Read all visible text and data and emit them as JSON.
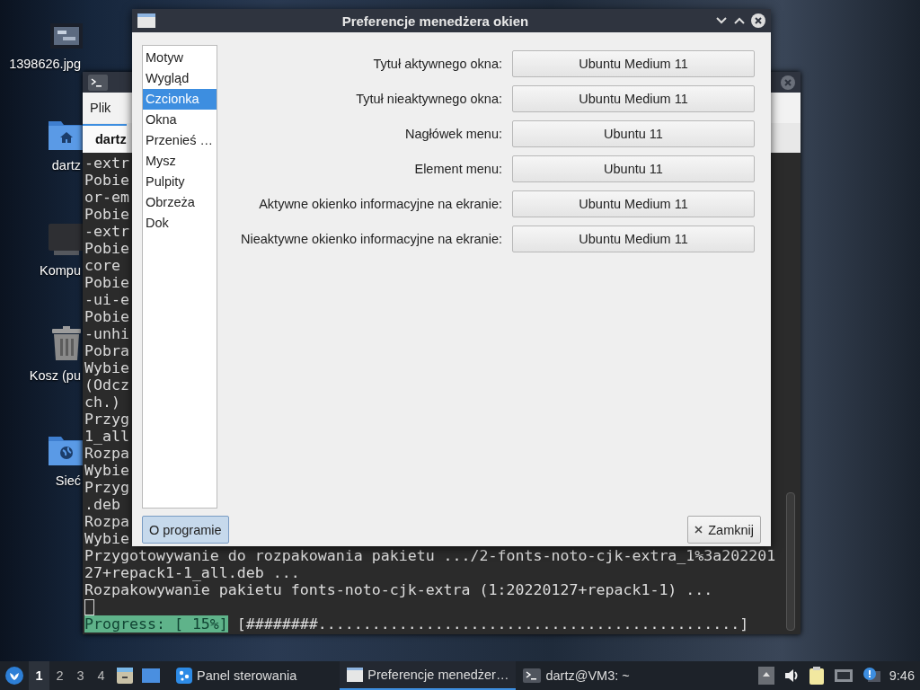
{
  "desktop_icons": [
    {
      "label": "1398626.jpg",
      "kind": "image"
    },
    {
      "label": "dartz",
      "kind": "home"
    },
    {
      "label": "Kompu",
      "kind": "computer"
    },
    {
      "label": "Kosz (pu",
      "kind": "trash"
    },
    {
      "label": "Sieć",
      "kind": "network"
    }
  ],
  "terminal": {
    "menu": [
      "Plik"
    ],
    "tab": "dartz",
    "covered_lines": [
      "-extr",
      "Pobie",
      "or-em",
      "Pobie",
      "-extr",
      "Pobie",
      "core",
      "Pobie",
      "-ui-e",
      "Pobie",
      "-unhi",
      "Pobra",
      "Wybie",
      "(Odcz",
      "ch.)",
      "Przyg",
      "1_all",
      "Rozpa",
      "Wybie",
      "Przyg",
      ".deb",
      "Rozpa",
      "Wybie"
    ],
    "lines": [
      "Przygotowywanie do rozpakowania pakietu .../2-fonts-noto-cjk-extra_1%3a202201",
      "27+repack1-1_all.deb ...",
      "Rozpakowywanie pakietu fonts-noto-cjk-extra (1:20220127+repack1-1) ..."
    ],
    "progress_label": "Progress: [ 15%]",
    "progress_bar": "[########...............................................]"
  },
  "dialog": {
    "title": "Preferencje menedżera okien",
    "sidebar": [
      {
        "label": "Motyw",
        "selected": false
      },
      {
        "label": "Wygląd",
        "selected": false
      },
      {
        "label": "Czcionka",
        "selected": true
      },
      {
        "label": "Okna",
        "selected": false
      },
      {
        "label": "Przenieś …",
        "selected": false
      },
      {
        "label": "Mysz",
        "selected": false
      },
      {
        "label": "Pulpity",
        "selected": false
      },
      {
        "label": "Obrzeża",
        "selected": false
      },
      {
        "label": "Dok",
        "selected": false
      }
    ],
    "fonts": [
      {
        "label": "Tytuł aktywnego okna:",
        "value": "Ubuntu Medium 11"
      },
      {
        "label": "Tytuł nieaktywnego okna:",
        "value": "Ubuntu Medium 11"
      },
      {
        "label": "Nagłówek menu:",
        "value": "Ubuntu 11"
      },
      {
        "label": "Element menu:",
        "value": "Ubuntu 11"
      },
      {
        "label": "Aktywne okienko informacyjne na ekranie:",
        "value": "Ubuntu Medium 11"
      },
      {
        "label": "Nieaktywne okienko informacyjne na ekranie:",
        "value": "Ubuntu Medium 11"
      }
    ],
    "buttons": [
      {
        "label": "O programie",
        "kind": "about"
      },
      {
        "label": "Zamknij",
        "kind": "close"
      }
    ]
  },
  "taskbar": {
    "workspaces": [
      {
        "label": "1",
        "selected": true
      },
      {
        "label": "2",
        "selected": false
      },
      {
        "label": "3",
        "selected": false
      },
      {
        "label": "4",
        "selected": false
      }
    ],
    "tasks": [
      {
        "label": "Panel sterowania",
        "kind": "control-panel",
        "selected": false
      },
      {
        "label": "Preferencje menedżer…",
        "kind": "window",
        "selected": true
      },
      {
        "label": "dartz@VM3: ~",
        "kind": "terminal",
        "selected": false
      }
    ],
    "clock": "9:46"
  }
}
